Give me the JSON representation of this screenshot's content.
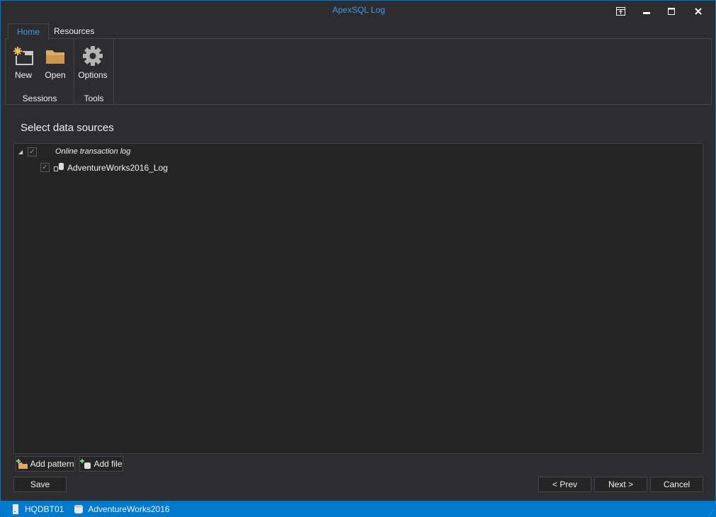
{
  "window": {
    "title": "ApexSQL Log"
  },
  "ribbon": {
    "tabs": [
      {
        "label": "Home",
        "active": true
      },
      {
        "label": "Resources",
        "active": false
      }
    ],
    "groups": [
      {
        "label": "Sessions",
        "buttons": [
          {
            "label": "New",
            "icon": "new-session-icon"
          },
          {
            "label": "Open",
            "icon": "folder-icon"
          }
        ]
      },
      {
        "label": "Tools",
        "buttons": [
          {
            "label": "Options",
            "icon": "gear-icon"
          }
        ]
      }
    ]
  },
  "main": {
    "heading": "Select data sources",
    "tree": {
      "root": {
        "label": "Online transaction log",
        "checked": true,
        "expanded": true
      },
      "children": [
        {
          "label": "AdventureWorks2016_Log",
          "checked": true
        }
      ]
    },
    "add_pattern": "Add pattern",
    "add_file": "Add file",
    "save": "Save",
    "prev": "< Prev",
    "next": "Next >",
    "cancel": "Cancel"
  },
  "status": {
    "server": "HQDBT01",
    "database": "AdventureWorks2016"
  },
  "colors": {
    "accent": "#007acc",
    "title": "#3d9be9",
    "folder": "#dcaa64"
  }
}
